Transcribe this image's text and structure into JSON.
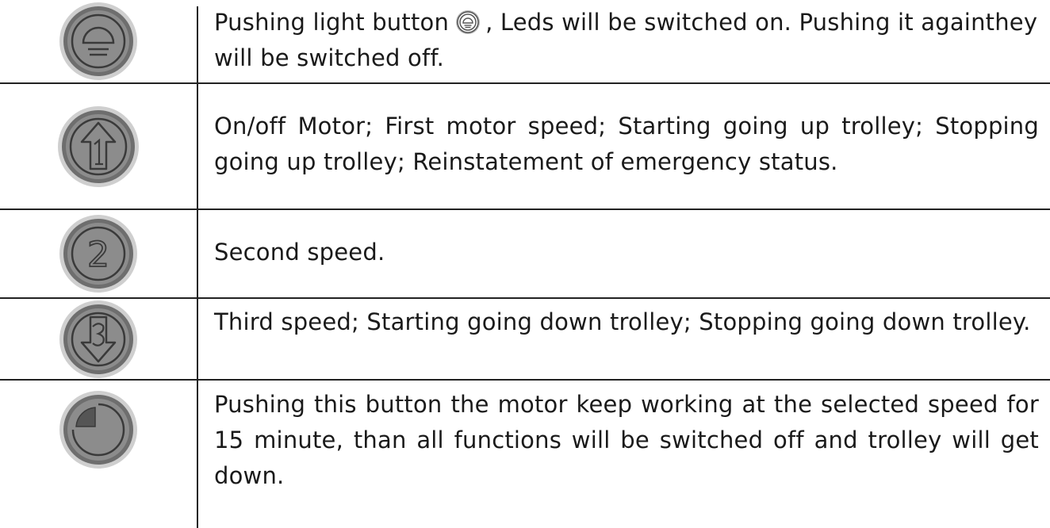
{
  "rows": [
    {
      "icon": "light-bulb-button-icon",
      "text_before": "Pushing light button",
      "inline_icon": "light-bulb-small-icon",
      "text_after": ", Leds will be switched on. Pushing it againthey will be switched off."
    },
    {
      "icon": "arrow-up-1-button-icon",
      "text": "On/off Motor; First  motor speed; Starting going up trolley; Stopping going up trolley; Reinstatement of emergency status."
    },
    {
      "icon": "number-2-button-icon",
      "label": "2",
      "text": "Second speed."
    },
    {
      "icon": "arrow-down-3-button-icon",
      "text": "Third speed; Starting going down trolley; Stopping going down trolley."
    },
    {
      "icon": "timer-button-icon",
      "text": "Pushing this button the motor keep working at the selected speed for 15 minute, than all functions will be switched off and trolley will get down."
    }
  ],
  "colors": {
    "button_face": "#8c8c8c",
    "button_ring_outer": "#6e6e6e",
    "button_halo": "#cfcfcf",
    "glyph": "#3a3a3a",
    "rule": "#222222"
  }
}
